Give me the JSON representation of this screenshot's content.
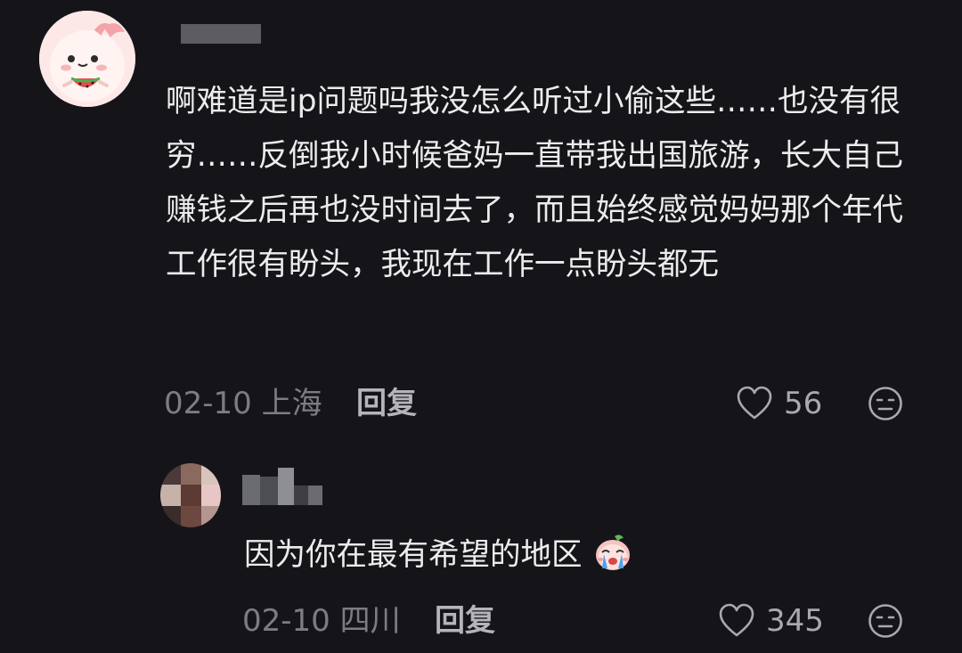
{
  "comment": {
    "text": "啊难道是ip问题吗我没怎么听过小偷这些……也没有很穷……反倒我小时候爸妈一直带我出国旅游，长大自己赚钱之后再也没时间去了，而且始终感觉妈妈那个年代工作很有盼头，我现在工作一点盼头都无",
    "date": "02-10",
    "location": "上海",
    "reply_label": "回复",
    "like_count": "56"
  },
  "reply": {
    "text": "因为你在最有希望的地区",
    "date": "02-10",
    "location": "四川",
    "reply_label": "回复",
    "like_count": "345"
  },
  "icons": {
    "like": "heart-outline-icon",
    "dislike": "meh-face-icon",
    "emoji": "crying-face-sticker"
  },
  "colors": {
    "background": "#151519",
    "text": "#ececee",
    "meta": "#7c7c82"
  }
}
